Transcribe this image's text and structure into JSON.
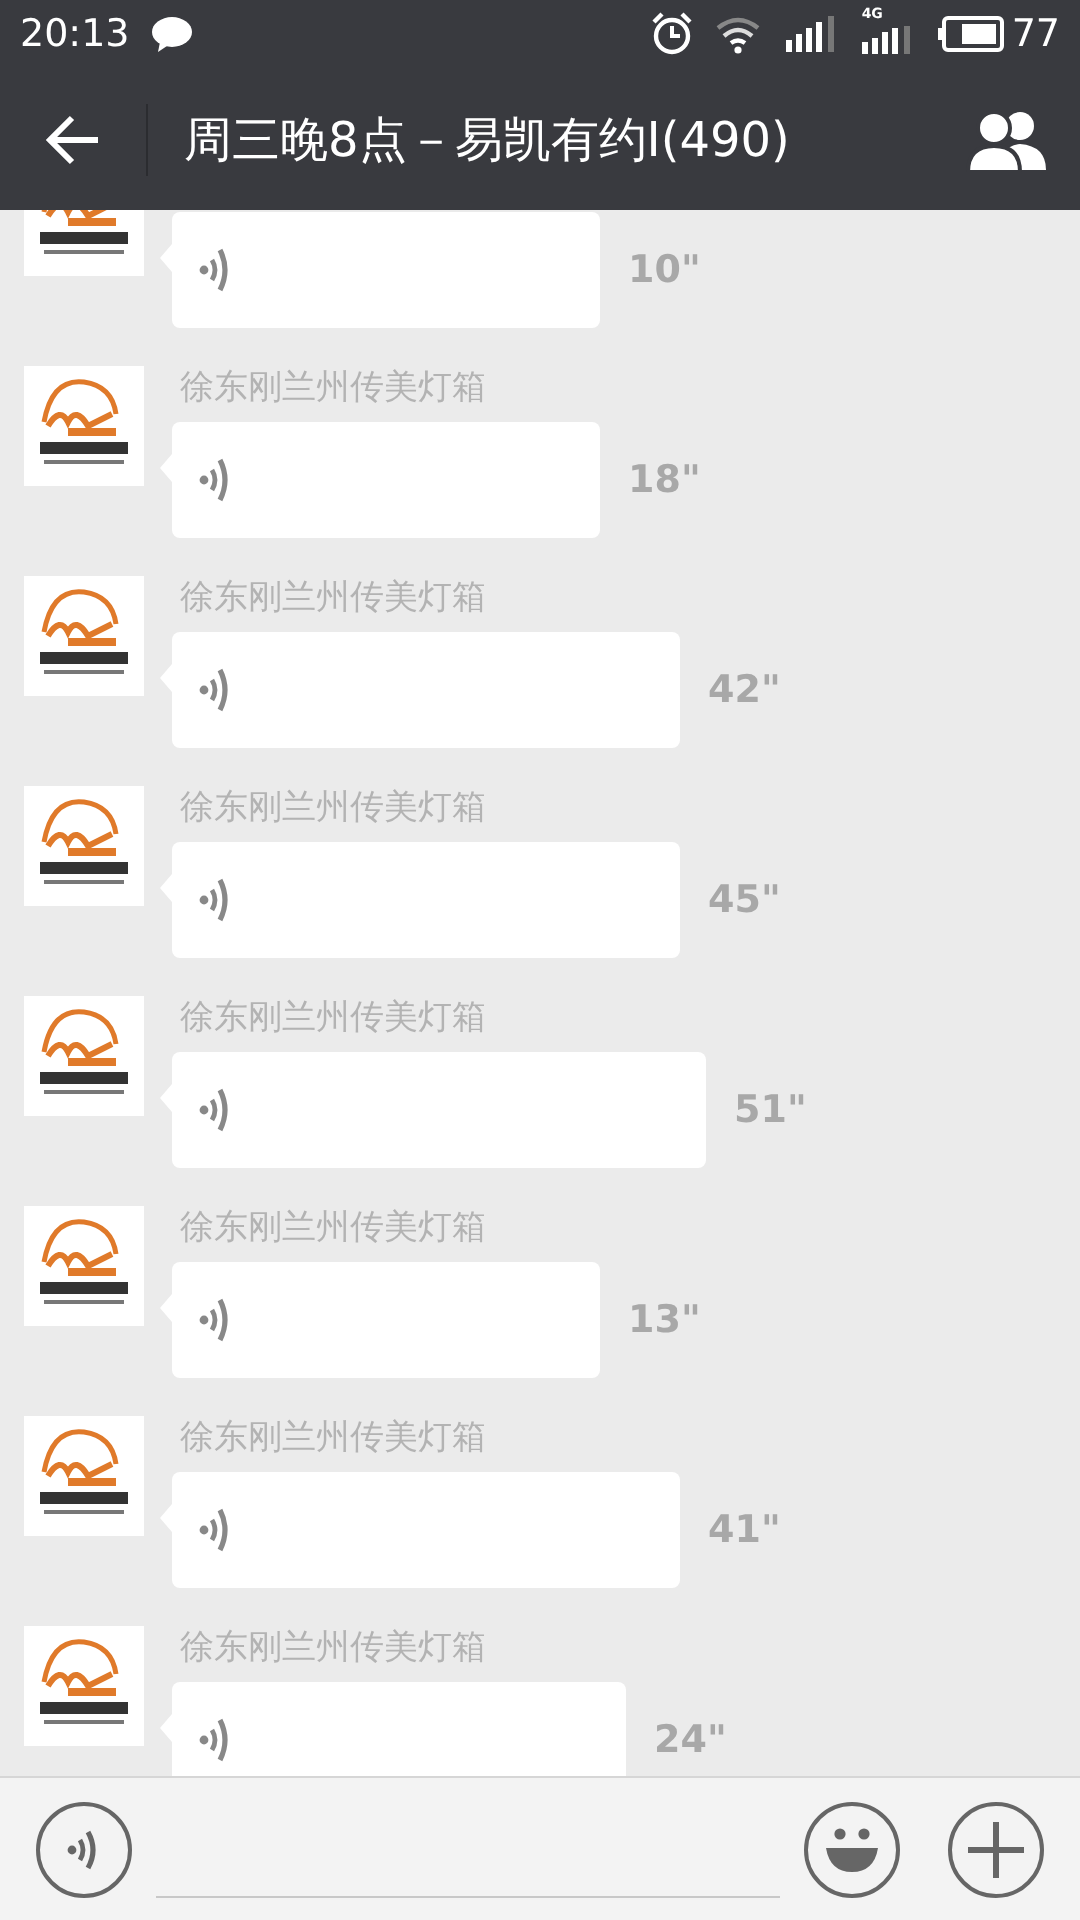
{
  "status_bar": {
    "time": "20:13",
    "network_label": "4G",
    "battery": "77"
  },
  "header": {
    "title": "周三晚8点－易凯有约I(490)"
  },
  "messages": [
    {
      "duration": "10\""
    },
    {
      "sender": "徐东刚兰州传美灯箱",
      "duration": "18\""
    },
    {
      "sender": "徐东刚兰州传美灯箱",
      "duration": "42\""
    },
    {
      "sender": "徐东刚兰州传美灯箱",
      "duration": "45\""
    },
    {
      "sender": "徐东刚兰州传美灯箱",
      "duration": "51\""
    },
    {
      "sender": "徐东刚兰州传美灯箱",
      "duration": "13\""
    },
    {
      "sender": "徐东刚兰州传美灯箱",
      "duration": "41\""
    },
    {
      "sender": "徐东刚兰州传美灯箱",
      "duration": "24\""
    }
  ]
}
